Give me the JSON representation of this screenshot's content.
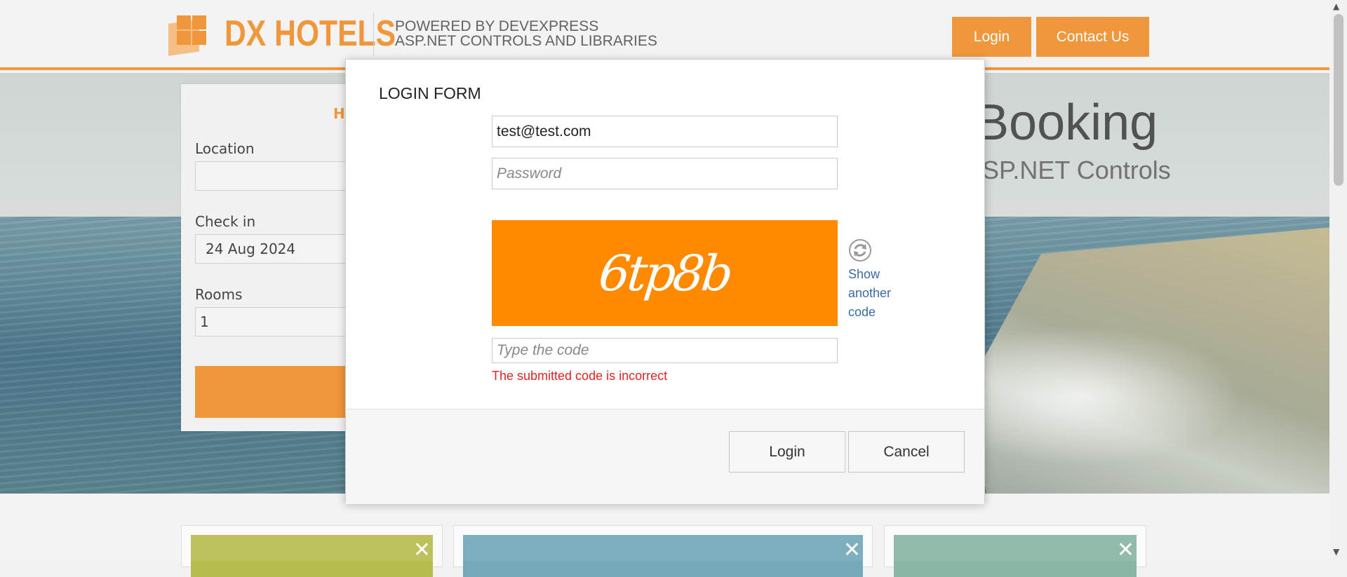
{
  "header": {
    "brand": "DX HOTELS",
    "powered_line1": "POWERED BY DEVEXPRESS",
    "powered_line2": "ASP.NET CONTROLS AND LIBRARIES",
    "login_label": "Login",
    "contact_label": "Contact Us",
    "accent": "#ef8e2b"
  },
  "hero": {
    "title_fragment": "Booking",
    "subtitle_fragment": "SP.NET Controls"
  },
  "search": {
    "heading_fragment": "H",
    "location_label": "Location",
    "location_value": "",
    "checkin_label": "Check in",
    "checkin_value": "24 Aug 2024",
    "rooms_label": "Rooms",
    "rooms_value": "1"
  },
  "tiles": [
    {
      "color": "#b7bc4f"
    },
    {
      "color": "#74a9b9"
    },
    {
      "color": "#8ab6a4"
    }
  ],
  "login_form": {
    "title": "LOGIN FORM",
    "email_value": "test@test.com",
    "password_placeholder": "Password",
    "captcha_text": "6tp8b",
    "captcha_color": "#ff8a00",
    "show_another_code": "Show another code",
    "code_placeholder": "Type the code",
    "error_message": "The submitted code is incorrect",
    "error_color": "#e02424",
    "login_button": "Login",
    "cancel_button": "Cancel"
  }
}
